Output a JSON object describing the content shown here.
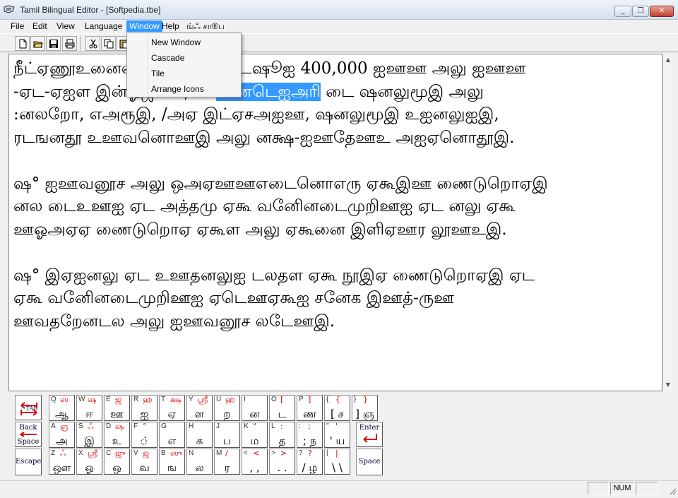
{
  "window": {
    "title": "Tamil Bilingual Editor - [Softpedia.tbe]",
    "minimize": "_",
    "restore": "❐",
    "close": "✕"
  },
  "menu": {
    "items": [
      "File",
      "Edit",
      "View",
      "Language",
      "Window",
      "Help",
      "ங்ஃ சா®ப"
    ],
    "active": "Window"
  },
  "window_menu": {
    "items": [
      "New Window",
      "Cascade",
      "Tile",
      "Arrange Icons"
    ]
  },
  "toolbar": {
    "buttons": [
      "new-icon",
      "open-icon",
      "save-icon",
      "print-icon",
      "cut-icon",
      "copy-icon",
      "paste-icon"
    ]
  },
  "document": {
    "lines": [
      {
        "before": "நீட்ஏணூஉனைலங்கஙஙஐள ட் டஷூஐ 400,000 ஐஊஊ அலு ஐஊஊ",
        "selected": "",
        "after": ""
      },
      {
        "before": "-ஏட-ஏஐள இன்ஓஜூரைக்க ",
        "selected": "ணைடெஐஅரி",
        "after": " டை ஷனலுமூஇ அலு"
      },
      {
        "before": ":னலறோ, எஅரூஇ, /அஏ இட்ஏசஅஐஊ, ஷனலுமூஇ உஐனலுஐஇ,",
        "selected": "",
        "after": ""
      },
      {
        "before": "ரடஙனதூ உஊவனொஊஇ அலு னக்ஷ-ஐஊதேஊஉ அஐஏனொதூஇ.",
        "selected": "",
        "after": ""
      },
      {
        "before": "",
        "selected": "",
        "after": ""
      },
      {
        "before": "ஷ° ஐஊவனூச அலு ஒஅஏஊஊஎடைனொஎரு ஏகூஇஊ ணைடுறொஏஇ",
        "selected": "",
        "after": ""
      },
      {
        "before": "னல டைஉஊஐ ஏட அத்தமு ஏகூ வனிேனடைமுறிஊஐ ஏட னலு ஏகூ",
        "selected": "",
        "after": ""
      },
      {
        "before": "ஊஓஅஏஏ ணைடுறொஏ ஏகூள அலு ஏகூனை இளிஏஊர லூஊஉஇ.",
        "selected": "",
        "after": ""
      },
      {
        "before": "",
        "selected": "",
        "after": ""
      },
      {
        "before": "ஷ° இஏஐனலு ஏட உஊதனலுஐ டலதள ஏகூ நூஇஏ ணைடுறொஏஇ ஏட",
        "selected": "",
        "after": ""
      },
      {
        "before": "ஏகூ வனிேனடைமுறிஊஐ ஏடெஊஏகூஐ சனேக இஊத்-ருஊ",
        "selected": "",
        "after": ""
      },
      {
        "before": "ஊவதறேனடல அலு ஐஊவனூச லடேஊஇ.",
        "selected": "",
        "after": ""
      }
    ]
  },
  "keyboard": {
    "row1": [
      {
        "tl": "Q",
        "tr": "ஸ",
        "b": "ஆ"
      },
      {
        "tl": "W",
        "tr": "ஷ",
        "b": "ஈ"
      },
      {
        "tl": "E",
        "tr": "ஜ",
        "b": "ஊ"
      },
      {
        "tl": "R",
        "tr": "ஹ",
        "b": "ஐ"
      },
      {
        "tl": "T",
        "tr": "க்ஷ",
        "b": "ஏ"
      },
      {
        "tl": "Y",
        "tr": "ஸ்ரீ",
        "b": "ள"
      },
      {
        "tl": "U",
        "tr": "ஹ",
        "b": "ற"
      },
      {
        "tl": "I",
        "tr": "",
        "b": "ன"
      },
      {
        "tl": "O",
        "tr": "[",
        "b": "ட"
      },
      {
        "tl": "P",
        "tr": "]",
        "b": "ண"
      },
      {
        "tl": "{",
        "tr": "{",
        "b": "[ ச"
      },
      {
        "tl": "}",
        "tr": "}",
        "b": "] ஞ"
      }
    ],
    "row2": [
      {
        "tl": "A",
        "tr": "ஞ",
        "b": "அ"
      },
      {
        "tl": "S",
        "tr": "ஃ",
        "b": "இ"
      },
      {
        "tl": "D",
        "tr": "ஷ",
        "b": "உ"
      },
      {
        "tl": "F",
        "tr": "°",
        "b": "்"
      },
      {
        "tl": "G",
        "tr": "",
        "b": "எ"
      },
      {
        "tl": "H",
        "tr": "",
        "b": "க"
      },
      {
        "tl": "J",
        "tr": "",
        "b": "ப"
      },
      {
        "tl": "K",
        "tr": "\"",
        "b": "ம"
      },
      {
        "tl": "L",
        "tr": ":",
        "b": "த"
      },
      {
        "tl": ":",
        "tr": ";",
        "b": "; ந"
      },
      {
        "tl": "\"",
        "tr": "'",
        "b": "' ய"
      }
    ],
    "row3": [
      {
        "tl": "Z",
        "tr": "ஃ",
        "b": "ஔ"
      },
      {
        "tl": "X",
        "tr": "ஸ்ரீ",
        "b": "ஓ"
      },
      {
        "tl": "C",
        "tr": "ஜு",
        "b": "ஒ"
      },
      {
        "tl": "V",
        "tr": "ஜ",
        "b": "வ"
      },
      {
        "tl": "B",
        "tr": "ஸு",
        "b": "ங"
      },
      {
        "tl": "N",
        "tr": "",
        "b": "ல"
      },
      {
        "tl": "M",
        "tr": "/",
        "b": "ர"
      },
      {
        "tl": "<",
        "tr": "<",
        "b": ", ,"
      },
      {
        "tl": ">",
        "tr": ">",
        "b": ". ."
      },
      {
        "tl": "?",
        "tr": "?",
        "b": "/ ழ"
      },
      {
        "tl": "|",
        "tr": "|",
        "b": "\\ \\"
      }
    ],
    "tab_label": "TAB",
    "backspace_label": "Back",
    "backspace_sub": "Space",
    "escape_label": "Escape",
    "enter_label": "Enter",
    "space_label": "Space"
  },
  "status": {
    "num": "NUM"
  },
  "colors": {
    "selection": "#3399ff",
    "menu_highlight": "#3399ff",
    "key_shift_char": "#dd0000"
  }
}
